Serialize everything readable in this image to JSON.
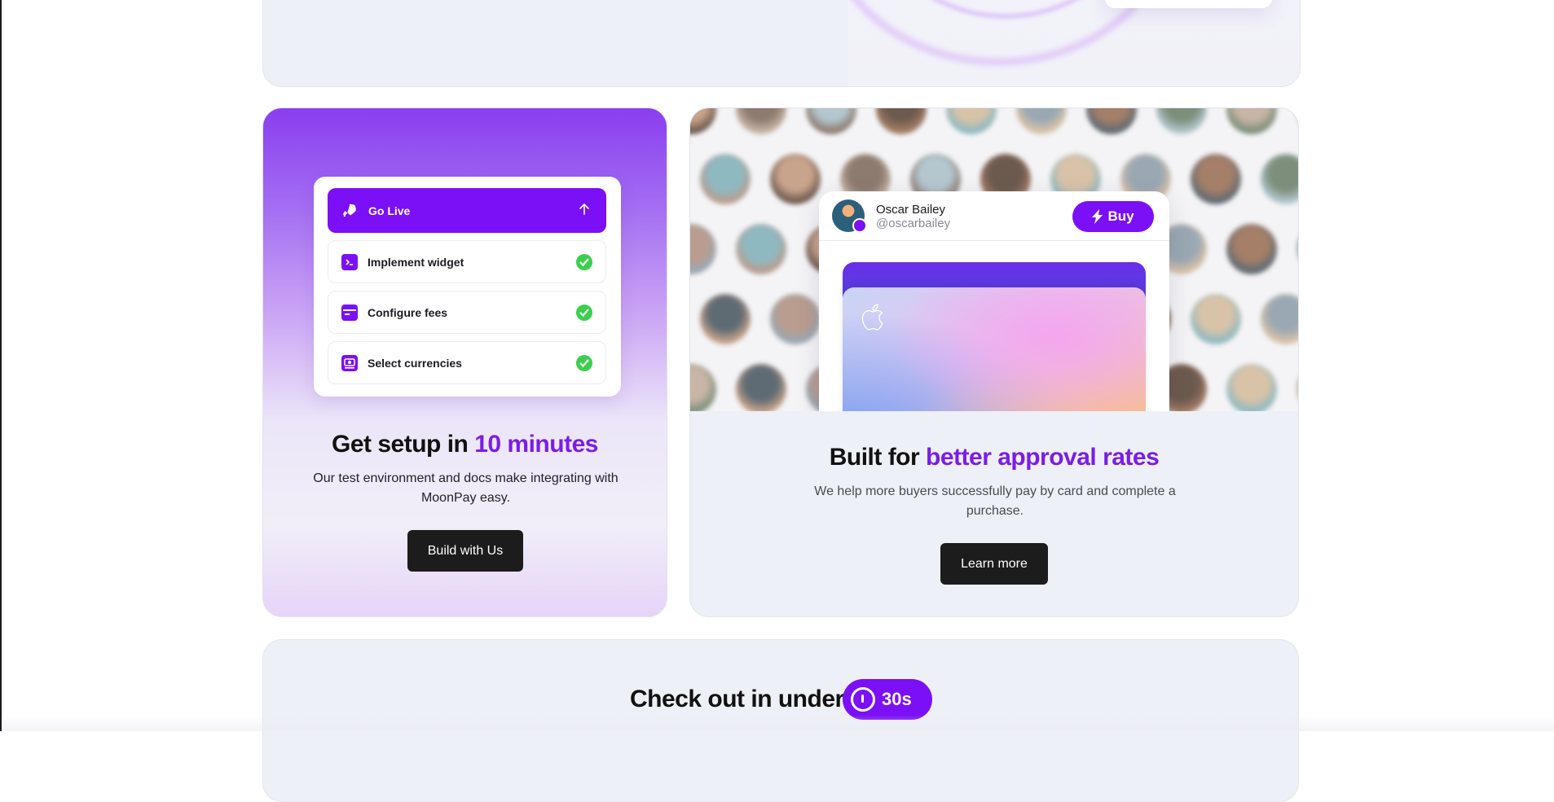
{
  "setup_card": {
    "checklist": {
      "go_live_label": "Go Live",
      "tasks": [
        {
          "label": "Implement widget",
          "icon": "terminal-icon",
          "status": "done"
        },
        {
          "label": "Configure fees",
          "icon": "credit-card-icon",
          "status": "done"
        },
        {
          "label": "Select currencies",
          "icon": "currency-icon",
          "status": "done"
        }
      ]
    },
    "title_prefix": "Get setup in ",
    "title_accent": "10 minutes",
    "description": "Our test environment and docs make integrating with MoonPay easy.",
    "button_label": "Build with Us"
  },
  "approval_card": {
    "profile": {
      "name": "Oscar Bailey",
      "handle": "@oscarbailey",
      "buy_label": "Buy"
    },
    "title_prefix": "Built for ",
    "title_accent": "better approval rates",
    "description": "We help more buyers successfully pay by card and complete a purchase.",
    "button_label": "Learn more"
  },
  "checkout_card": {
    "title": "Check out in under",
    "timer_label": "30s"
  },
  "colors": {
    "accent": "#7b0ff5",
    "accent_text": "#7a1de8",
    "success": "#3ccf4e",
    "button_dark": "#1c1c1c",
    "card_bg": "#eef0f7"
  }
}
